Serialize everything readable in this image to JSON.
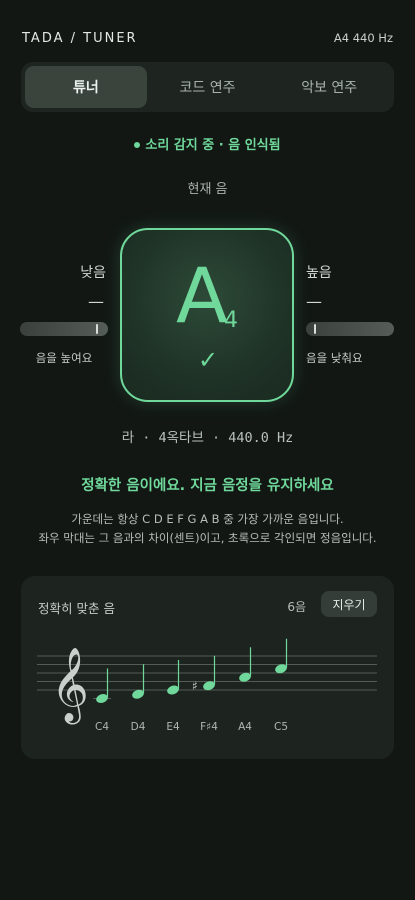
{
  "header": {
    "app_title": "TADA / TUNER",
    "tuning": "A4  440 Hz"
  },
  "tabs": [
    {
      "label": "튜너",
      "active": true
    },
    {
      "label": "코드 연주",
      "active": false
    },
    {
      "label": "악보 연주",
      "active": false
    }
  ],
  "status": {
    "text": "소리 감지 중 · 음 인식됨"
  },
  "tuner": {
    "current_label": "현재 음",
    "note_letter": "A",
    "note_octave": "4",
    "check_symbol": "✓",
    "low_side": {
      "title": "낮음",
      "dash": "—",
      "hint": "음을 높여요",
      "level": 0.88
    },
    "high_side": {
      "title": "높음",
      "dash": "—",
      "hint": "음을 낮춰요",
      "level": 0.1
    },
    "note_detail": "라 · 4옥타브 · 440.0 Hz",
    "message": "정확한 음이에요. 지금 음정을 유지하세요",
    "explain_line1": "가운데는 항상 C D E F G A B 중 가장 가까운 음입니다.",
    "explain_line2": "좌우 막대는 그 음과의 차이(센트)이고, 초록으로 각인되면 정음입니다."
  },
  "history": {
    "title": "정확히 맞춘 음",
    "count": "6음",
    "clear_label": "지우기",
    "clef_symbol": "𝄞",
    "sharp_symbol": "♯",
    "notes": [
      {
        "name": "C4",
        "step": 0,
        "sharp": false
      },
      {
        "name": "D4",
        "step": 1,
        "sharp": false
      },
      {
        "name": "E4",
        "step": 2,
        "sharp": false
      },
      {
        "name": "F♯4",
        "step": 3,
        "sharp": true
      },
      {
        "name": "A4",
        "step": 5,
        "sharp": false
      },
      {
        "name": "C5",
        "step": 7,
        "sharp": false
      }
    ],
    "note_color": "#6fd89a"
  },
  "colors": {
    "accent": "#6fd89a",
    "background": "#121714"
  }
}
